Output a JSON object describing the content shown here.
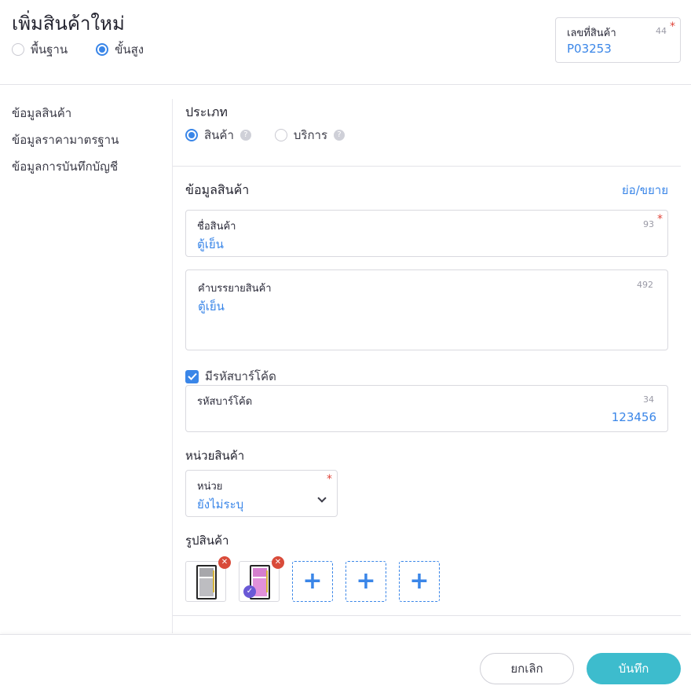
{
  "page": {
    "title": "เพิ่มสินค้าใหม่"
  },
  "mode": {
    "options": [
      "พื้นฐาน",
      "ขั้นสูง"
    ],
    "selected": "ขั้นสูง"
  },
  "product_code": {
    "label": "เลขที่สินค้า",
    "counter": "44",
    "required_mark": "*",
    "value": "P03253"
  },
  "sidebar": {
    "items": [
      {
        "label": "ข้อมูลสินค้า"
      },
      {
        "label": "ข้อมูลราคามาตรฐาน"
      },
      {
        "label": "ข้อมูลการบันทึกบัญชี"
      }
    ]
  },
  "type": {
    "title": "ประเภท",
    "options": [
      "สินค้า",
      "บริการ"
    ],
    "selected": "สินค้า",
    "help_glyph": "?"
  },
  "product_info": {
    "title": "ข้อมูลสินค้า",
    "collapse_label": "ย่อ/ขยาย",
    "name": {
      "label": "ชื่อสินค้า",
      "counter": "93",
      "required_mark": "*",
      "value": "ตู้เย็น"
    },
    "description": {
      "label": "คำบรรยายสินค้า",
      "counter": "492",
      "value": "ตู้เย็น"
    },
    "barcode_toggle": {
      "label": "มีรหัสบาร์โค้ด",
      "checked": true
    },
    "barcode": {
      "label": "รหัสบาร์โค้ด",
      "counter": "34",
      "value": "123456"
    }
  },
  "unit": {
    "title": "หน่วยสินค้า",
    "label": "หน่วย",
    "required_mark": "*",
    "value": "ยังไม่ระบุ"
  },
  "images": {
    "title": "รูปสินค้า",
    "thumbnails": [
      {
        "color": "silver",
        "is_main": false
      },
      {
        "color": "pink",
        "is_main": true
      }
    ],
    "add_slots": 3,
    "add_glyph": "+",
    "remove_glyph": "✕",
    "main_glyph": "✓"
  },
  "footer": {
    "cancel_label": "ยกเลิก",
    "save_label": "บันทึก"
  },
  "colors": {
    "accent": "#3a86e8",
    "save": "#3dbccd",
    "required": "#e0453a",
    "remove": "#d94b3a",
    "main_badge": "#6a59d6"
  }
}
